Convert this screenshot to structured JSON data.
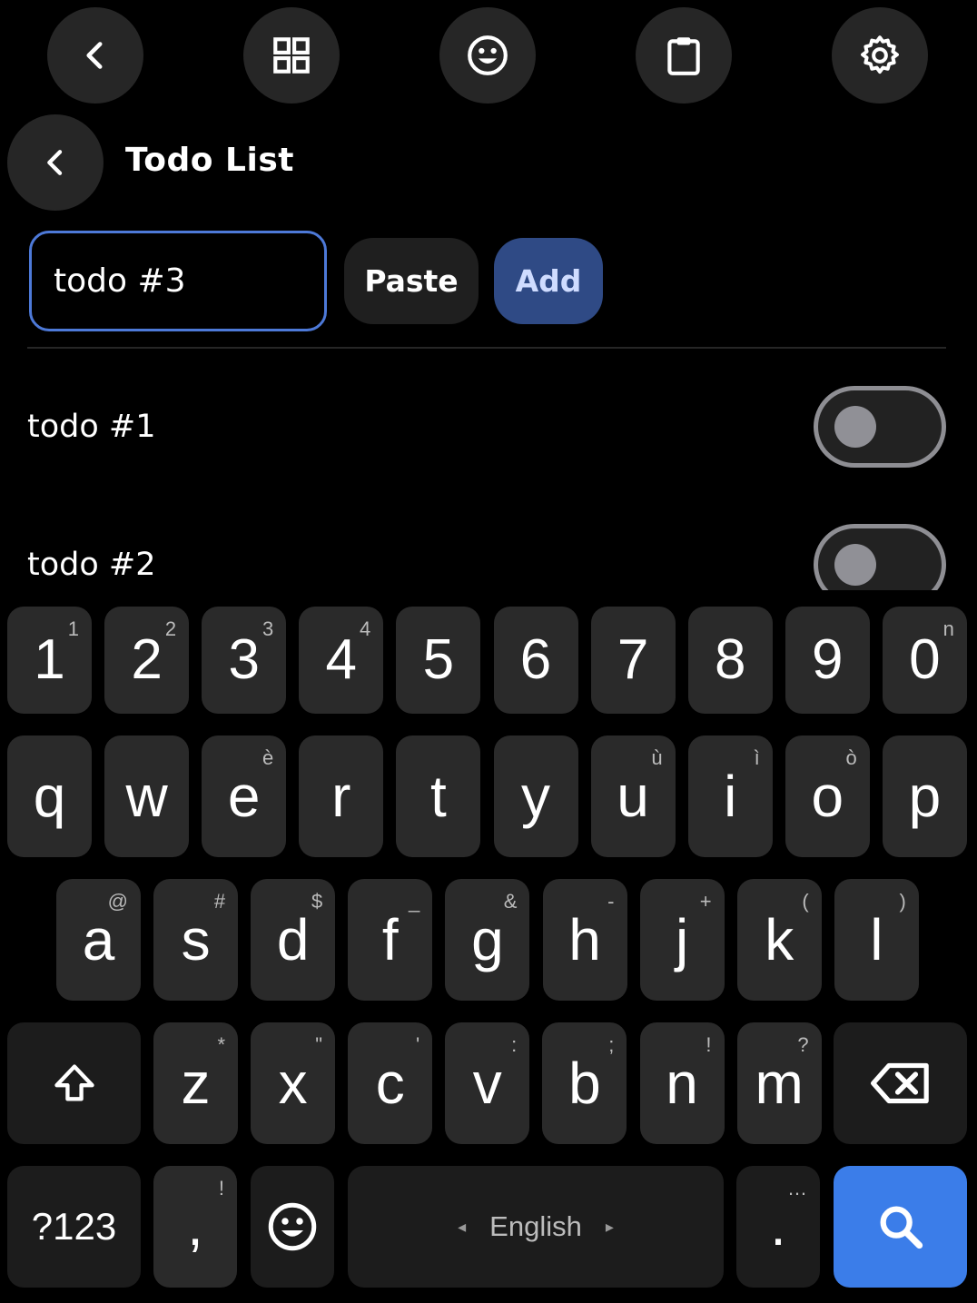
{
  "toolbar": {
    "buttons": [
      {
        "name": "back-icon"
      },
      {
        "name": "grid-icon"
      },
      {
        "name": "emoji-icon"
      },
      {
        "name": "clipboard-icon"
      },
      {
        "name": "settings-icon"
      }
    ]
  },
  "header": {
    "title": "Todo List",
    "back_icon": "chevron-left-icon"
  },
  "input_row": {
    "input_value": "todo #3",
    "paste_label": "Paste",
    "add_label": "Add"
  },
  "todos": [
    {
      "label": "todo #1",
      "done": false
    },
    {
      "label": "todo #2",
      "done": false
    }
  ],
  "keyboard": {
    "row_numbers": [
      {
        "main": "1",
        "hint": "1"
      },
      {
        "main": "2",
        "hint": "2"
      },
      {
        "main": "3",
        "hint": "3"
      },
      {
        "main": "4",
        "hint": "4"
      },
      {
        "main": "5",
        "hint": ""
      },
      {
        "main": "6",
        "hint": ""
      },
      {
        "main": "7",
        "hint": ""
      },
      {
        "main": "8",
        "hint": ""
      },
      {
        "main": "9",
        "hint": ""
      },
      {
        "main": "0",
        "hint": "n"
      }
    ],
    "row_top": [
      {
        "main": "q",
        "hint": ""
      },
      {
        "main": "w",
        "hint": ""
      },
      {
        "main": "e",
        "hint": "è"
      },
      {
        "main": "r",
        "hint": ""
      },
      {
        "main": "t",
        "hint": ""
      },
      {
        "main": "y",
        "hint": ""
      },
      {
        "main": "u",
        "hint": "ù"
      },
      {
        "main": "i",
        "hint": "ì"
      },
      {
        "main": "o",
        "hint": "ò"
      },
      {
        "main": "p",
        "hint": ""
      }
    ],
    "row_middle": [
      {
        "main": "a",
        "hint": "@"
      },
      {
        "main": "s",
        "hint": "#"
      },
      {
        "main": "d",
        "hint": "$"
      },
      {
        "main": "f",
        "hint": "_"
      },
      {
        "main": "g",
        "hint": "&"
      },
      {
        "main": "h",
        "hint": "-"
      },
      {
        "main": "j",
        "hint": "+"
      },
      {
        "main": "k",
        "hint": "("
      },
      {
        "main": "l",
        "hint": ")"
      }
    ],
    "row_bottom": [
      {
        "main": "z",
        "hint": "*"
      },
      {
        "main": "x",
        "hint": "\""
      },
      {
        "main": "c",
        "hint": "'"
      },
      {
        "main": "v",
        "hint": ":"
      },
      {
        "main": "b",
        "hint": ";"
      },
      {
        "main": "n",
        "hint": "!"
      },
      {
        "main": "m",
        "hint": "?"
      }
    ],
    "symbols_label": "?123",
    "comma": {
      "main": ",",
      "hint": "!"
    },
    "space_label": "English",
    "space_left_arrow": "◂",
    "space_right_arrow": "▸",
    "period": {
      "main": ".",
      "hint": "…"
    },
    "shift_icon": "shift-icon",
    "backspace_icon": "backspace-icon",
    "emoji_icon": "emoji-icon",
    "search_icon": "search-icon",
    "action_color": "#3b7de9"
  }
}
